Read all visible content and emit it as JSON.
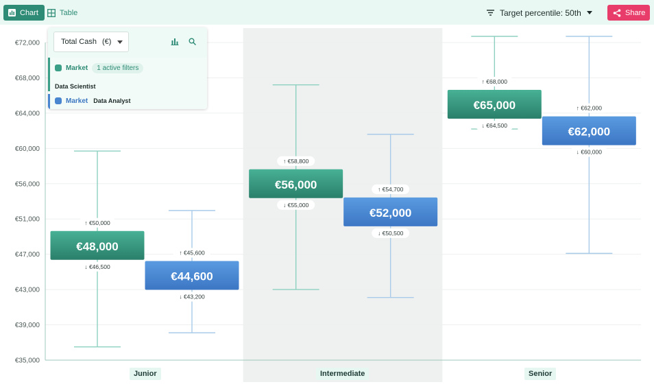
{
  "toolbar": {
    "chart_label": "Chart",
    "table_label": "Table",
    "percentile_label": "Target percentile: 50th",
    "share_label": "Share"
  },
  "panel": {
    "metric": "Total Cash",
    "currency": "(€)",
    "selections": [
      {
        "market_label": "Market",
        "filters": "1 active filters",
        "role": "Data Scientist",
        "color": "#3a9f86"
      },
      {
        "market_label": "Market",
        "role": "Data Analyst",
        "color": "#4a86d0"
      }
    ]
  },
  "chart_data": {
    "type": "box",
    "categories": [
      "Junior",
      "Intermediate",
      "Senior"
    ],
    "highlighted_category": "Intermediate",
    "y_ticks": [
      "€35,000",
      "€39,000",
      "€43,000",
      "€47,000",
      "€51,000",
      "€56,000",
      "€60,000",
      "€64,000",
      "€68,000",
      "€72,000"
    ],
    "series": [
      {
        "role": "Data Scientist",
        "color": "#3a9f86",
        "points": [
          {
            "category": "Junior",
            "min": 36500,
            "max": 59700,
            "q_low": 46500,
            "q_high": 50000,
            "median": 48000,
            "median_label": "€48,000",
            "high_label": "€50,000",
            "low_label": "€46,500"
          },
          {
            "category": "Intermediate",
            "min": 43000,
            "max": 67200,
            "q_low": 55000,
            "q_high": 58800,
            "median": 56000,
            "median_label": "€56,000",
            "high_label": "€58,800",
            "low_label": "€55,000"
          },
          {
            "category": "Senior",
            "min": 62200,
            "max": 72700,
            "q_low": 64500,
            "q_high": 68000,
            "median": 65000,
            "median_label": "€65,000",
            "high_label": "€68,000",
            "low_label": "€64,500"
          }
        ]
      },
      {
        "role": "Data Analyst",
        "color": "#4a86d0",
        "points": [
          {
            "category": "Junior",
            "min": 38100,
            "max": 52200,
            "q_low": 43200,
            "q_high": 45600,
            "median": 44600,
            "median_label": "€44,600",
            "high_label": "€45,600",
            "low_label": "€43,200"
          },
          {
            "category": "Intermediate",
            "min": 42100,
            "max": 61600,
            "q_low": 50500,
            "q_high": 54700,
            "median": 52000,
            "median_label": "€52,000",
            "high_label": "€54,700",
            "low_label": "€50,500"
          },
          {
            "category": "Senior",
            "min": 47100,
            "max": 72700,
            "q_low": 60000,
            "q_high": 62000,
            "median": 62000,
            "median_label": "€62,000",
            "high_label": "€62,000",
            "low_label": "€60,000"
          }
        ]
      }
    ]
  }
}
